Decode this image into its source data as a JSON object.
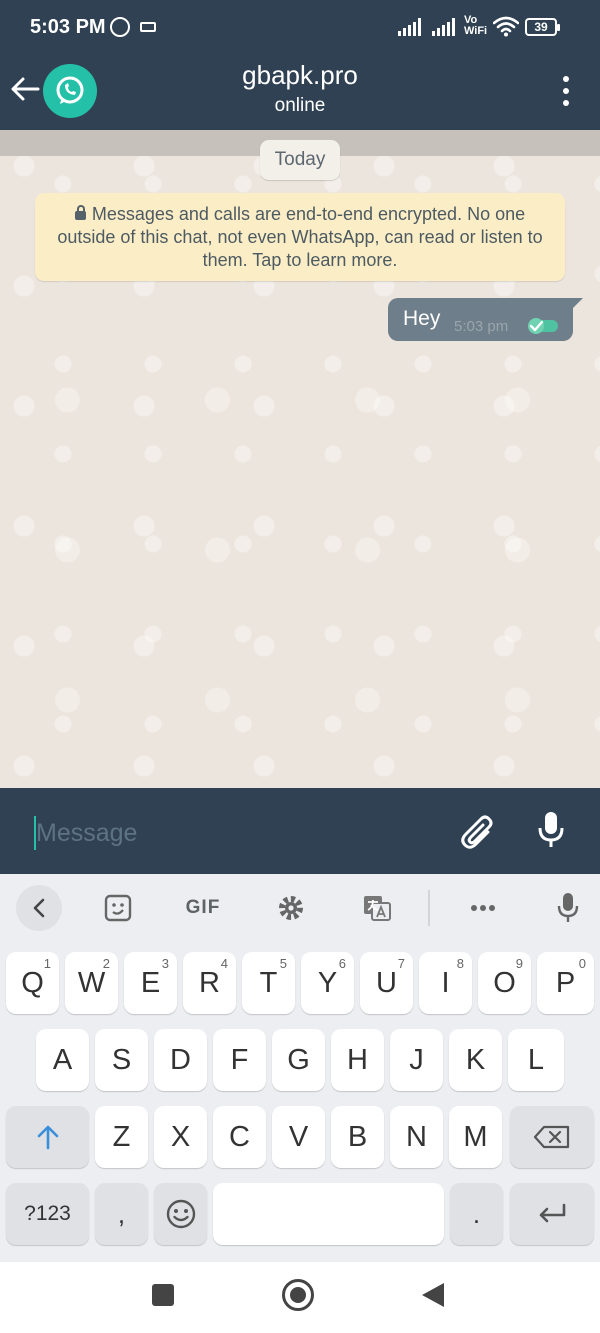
{
  "status_bar": {
    "time": "5:03 PM",
    "network_label_top": "Vo",
    "network_label_bottom": "WiFi",
    "battery": "39"
  },
  "header": {
    "title": "gbapk.pro",
    "status": "online"
  },
  "chat": {
    "date_chip": "Today",
    "encryption_notice": "Messages and calls are end-to-end encrypted. No one outside of this chat, not even WhatsApp, can read or listen to them. Tap to learn more.",
    "messages": [
      {
        "text": "Hey",
        "time": "5:03 pm"
      }
    ]
  },
  "input": {
    "placeholder": "Message"
  },
  "keyboard": {
    "toolbar": {
      "gif_label": "GIF"
    },
    "row1": [
      {
        "label": "Q",
        "hint": "1"
      },
      {
        "label": "W",
        "hint": "2"
      },
      {
        "label": "E",
        "hint": "3"
      },
      {
        "label": "R",
        "hint": "4"
      },
      {
        "label": "T",
        "hint": "5"
      },
      {
        "label": "Y",
        "hint": "6"
      },
      {
        "label": "U",
        "hint": "7"
      },
      {
        "label": "I",
        "hint": "8"
      },
      {
        "label": "O",
        "hint": "9"
      },
      {
        "label": "P",
        "hint": "0"
      }
    ],
    "row2": [
      "A",
      "S",
      "D",
      "F",
      "G",
      "H",
      "J",
      "K",
      "L"
    ],
    "row3": [
      "Z",
      "X",
      "C",
      "V",
      "B",
      "N",
      "M"
    ],
    "symbols_label": "?123",
    "comma_label": ",",
    "period_label": "."
  },
  "colors": {
    "header_bg": "#2f4152",
    "accent": "#25c0a8",
    "chat_bg": "#ece5dd",
    "outgoing_bubble": "#6e7e8a",
    "encryption_bg": "#fbeec7",
    "read_tick": "#4fc3a1"
  }
}
